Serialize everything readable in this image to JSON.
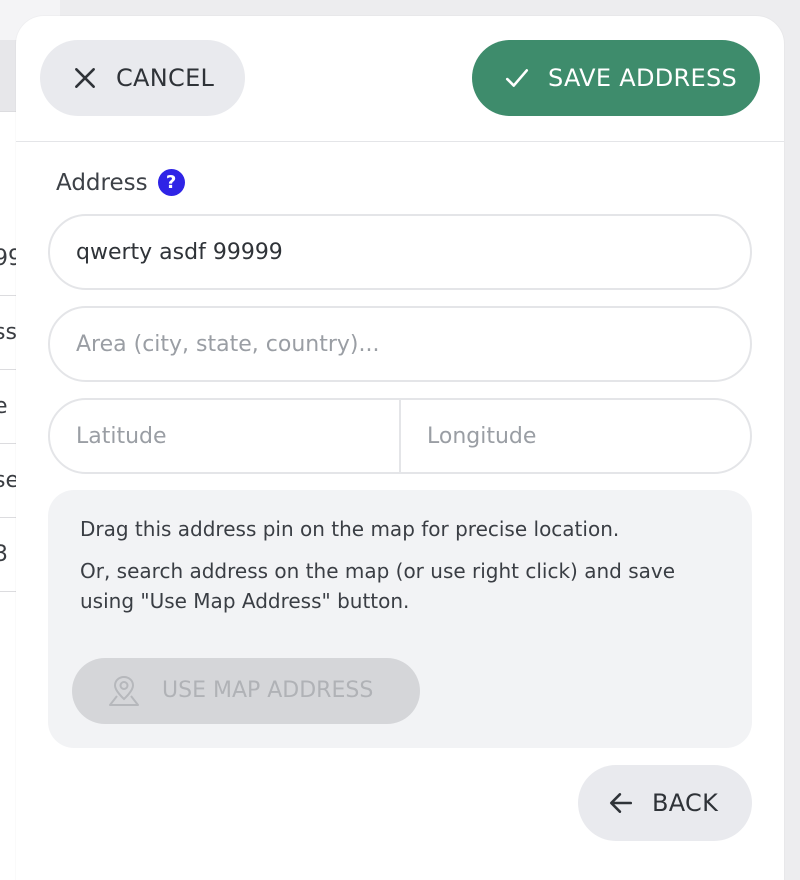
{
  "background_list": {
    "rows": [
      "99",
      "ss",
      "e",
      "se",
      "3"
    ]
  },
  "toolbar": {
    "cancel_label": "CANCEL",
    "save_label": "SAVE ADDRESS"
  },
  "form": {
    "address_label": "Address",
    "help_icon": "?",
    "address_value": "qwerty asdf 99999",
    "area_placeholder": "Area (city, state, country)...",
    "latitude_placeholder": "Latitude",
    "longitude_placeholder": "Longitude"
  },
  "info": {
    "line1": "Drag this address pin on the map for precise location.",
    "line2": "Or, search address on the map (or use right click) and save using \"Use Map Address\" button.",
    "use_map_label": "USE MAP ADDRESS"
  },
  "footer": {
    "back_label": "BACK"
  },
  "colors": {
    "accent_save": "#3e8c6c",
    "help_badge": "#2f24e6"
  },
  "icons": {
    "cancel": "close-icon",
    "save": "check-icon",
    "help": "help-icon",
    "map": "map-pin-icon",
    "back": "arrow-left-icon"
  }
}
